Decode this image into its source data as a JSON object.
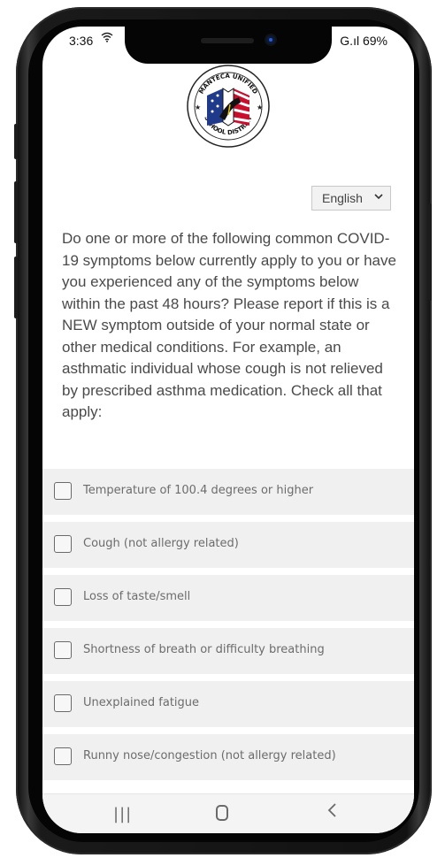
{
  "status_bar": {
    "time": "3:36",
    "right": "G.ıl 69%"
  },
  "logo": {
    "top_text": "MANTECA UNIFIED",
    "bottom_text": "SCHOOL DISTRICT"
  },
  "language": {
    "selected": "English"
  },
  "question": "Do one or more of the following common COVID-19 symptoms below currently apply to you or have you experienced any of the symptoms below within the past 48 hours? Please report if this is a NEW symptom outside of your normal state or other medical conditions. For example, an asthmatic individual whose cough is not relieved by prescribed asthma medication. Check all that apply:",
  "symptoms": [
    {
      "label": "Temperature of 100.4 degrees or higher"
    },
    {
      "label": "Cough (not allergy related)"
    },
    {
      "label": "Loss of taste/smell"
    },
    {
      "label": "Shortness of breath or difficulty breathing"
    },
    {
      "label": "Unexplained fatigue"
    },
    {
      "label": "Runny nose/congestion (not allergy related)"
    }
  ],
  "icons": {
    "wifi": "wifi-icon",
    "recent": "recent-apps-icon",
    "home": "home-icon",
    "back": "back-icon"
  },
  "colors": {
    "screen_bg": "#ffffff",
    "row_bg": "#f0f0f0",
    "text": "#4a4a4a",
    "logo_red": "#c8102e",
    "logo_blue": "#1f3a8a"
  }
}
